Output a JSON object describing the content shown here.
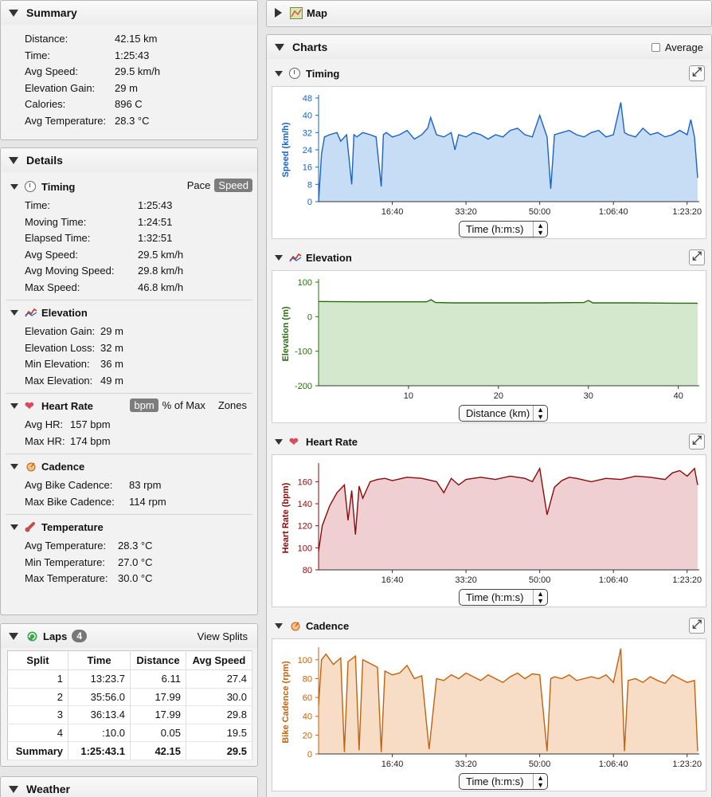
{
  "summary": {
    "title": "Summary",
    "rows": [
      {
        "label": "Distance:",
        "value": "42.15 km"
      },
      {
        "label": "Time:",
        "value": "1:25:43"
      },
      {
        "label": "Avg Speed:",
        "value": "29.5 km/h"
      },
      {
        "label": "Elevation Gain:",
        "value": "29 m"
      },
      {
        "label": "Calories:",
        "value": "896 C"
      },
      {
        "label": "Avg Temperature:",
        "value": "28.3 °C"
      }
    ]
  },
  "details": {
    "title": "Details",
    "timing": {
      "title": "Timing",
      "toggle": {
        "pace": "Pace",
        "speed": "Speed"
      },
      "rows": [
        {
          "label": "Time:",
          "value": "1:25:43"
        },
        {
          "label": "Moving Time:",
          "value": "1:24:51"
        },
        {
          "label": "Elapsed Time:",
          "value": "1:32:51"
        },
        {
          "label": "Avg Speed:",
          "value": "29.5 km/h"
        },
        {
          "label": "Avg Moving Speed:",
          "value": "29.8 km/h"
        },
        {
          "label": "Max Speed:",
          "value": "46.8 km/h"
        }
      ]
    },
    "elevation": {
      "title": "Elevation",
      "rows": [
        {
          "label": "Elevation Gain:",
          "value": "29 m"
        },
        {
          "label": "Elevation Loss:",
          "value": "32 m"
        },
        {
          "label": "Min Elevation:",
          "value": "36 m"
        },
        {
          "label": "Max Elevation:",
          "value": "49 m"
        }
      ]
    },
    "heart_rate": {
      "title": "Heart Rate",
      "toggle": {
        "bpm": "bpm",
        "pct": "% of Max",
        "zones": "Zones"
      },
      "rows": [
        {
          "label": "Avg HR:",
          "value": "157 bpm"
        },
        {
          "label": "Max HR:",
          "value": "174 bpm"
        }
      ]
    },
    "cadence": {
      "title": "Cadence",
      "rows": [
        {
          "label": "Avg Bike Cadence:",
          "value": "83 rpm"
        },
        {
          "label": "Max Bike Cadence:",
          "value": "114 rpm"
        }
      ]
    },
    "temperature": {
      "title": "Temperature",
      "rows": [
        {
          "label": "Avg Temperature:",
          "value": "28.3 °C"
        },
        {
          "label": "Min Temperature:",
          "value": "27.0 °C"
        },
        {
          "label": "Max Temperature:",
          "value": "30.0 °C"
        }
      ]
    }
  },
  "laps": {
    "title": "Laps",
    "count": "4",
    "view_splits": "View Splits",
    "columns": [
      "Split",
      "Time",
      "Distance",
      "Avg Speed"
    ],
    "rows": [
      [
        "1",
        "13:23.7",
        "6.11",
        "27.4"
      ],
      [
        "2",
        "35:56.0",
        "17.99",
        "30.0"
      ],
      [
        "3",
        "36:13.4",
        "17.99",
        "29.8"
      ],
      [
        "4",
        ":10.0",
        "0.05",
        "19.5"
      ]
    ],
    "summary_row": [
      "Summary",
      "1:25:43.1",
      "42.15",
      "29.5"
    ]
  },
  "weather": {
    "title": "Weather"
  },
  "map": {
    "title": "Map"
  },
  "charts": {
    "title": "Charts",
    "average_label": "Average",
    "colors": {
      "speed": "#1a63c6",
      "elevation": "#2a6b12",
      "hr": "#8b0a0a",
      "cadence": "#c4620e"
    }
  },
  "chart_data": [
    {
      "type": "area",
      "title": "Timing",
      "ylabel": "Speed (km/h)",
      "xlabel": "Time (h:m:s)",
      "xlim": [
        0,
        5143
      ],
      "ylim": [
        0,
        48
      ],
      "yticks": [
        0,
        8,
        16,
        24,
        32,
        40,
        48
      ],
      "xticks": [
        1000,
        2000,
        3000,
        4000,
        5000
      ],
      "xticklabels": [
        "16:40",
        "33:20",
        "50:00",
        "1:06:40",
        "1:23:20"
      ],
      "x": [
        0,
        40,
        80,
        150,
        250,
        300,
        380,
        450,
        480,
        520,
        600,
        700,
        780,
        850,
        880,
        920,
        1000,
        1100,
        1200,
        1300,
        1400,
        1480,
        1520,
        1600,
        1700,
        1800,
        1850,
        1900,
        2000,
        2100,
        2200,
        2300,
        2400,
        2500,
        2600,
        2700,
        2800,
        2900,
        3000,
        3100,
        3150,
        3200,
        3300,
        3400,
        3500,
        3600,
        3700,
        3800,
        3900,
        4000,
        4100,
        4150,
        4200,
        4300,
        4400,
        4500,
        4600,
        4700,
        4800,
        4900,
        5000,
        5050,
        5100,
        5143
      ],
      "series": [
        {
          "values": [
            0,
            22,
            30,
            31,
            32,
            28,
            31,
            8,
            31,
            30,
            32,
            31,
            30,
            7,
            31,
            32,
            30,
            31,
            33,
            29,
            31,
            34,
            39,
            31,
            30,
            32,
            24,
            31,
            30,
            32,
            31,
            29,
            31,
            30,
            33,
            34,
            31,
            30,
            40,
            30,
            6,
            31,
            32,
            33,
            31,
            30,
            32,
            33,
            30,
            31,
            46,
            32,
            31,
            30,
            34,
            31,
            32,
            30,
            31,
            33,
            31,
            38,
            30,
            11
          ]
        }
      ]
    },
    {
      "type": "area",
      "title": "Elevation",
      "ylabel": "Elevation (m)",
      "xlabel": "Distance (km)",
      "xlim": [
        0,
        42.15
      ],
      "ylim": [
        -200,
        100
      ],
      "yticks": [
        -200,
        -100,
        0,
        100
      ],
      "xticks": [
        10,
        20,
        30,
        40
      ],
      "x": [
        0,
        5,
        10,
        12,
        12.5,
        13,
        15,
        20,
        25,
        29.5,
        30,
        30.5,
        35,
        40,
        42.15
      ],
      "series": [
        {
          "values": [
            44,
            43,
            43,
            43,
            49,
            41,
            40,
            40,
            40,
            41,
            47,
            40,
            40,
            39,
            39
          ]
        }
      ]
    },
    {
      "type": "area",
      "title": "Heart Rate",
      "ylabel": "Heart Rate (bpm)",
      "xlabel": "Time (h:m:s)",
      "xlim": [
        0,
        5143
      ],
      "ylim": [
        80,
        174
      ],
      "yticks": [
        80,
        100,
        120,
        140,
        160
      ],
      "xticks": [
        1000,
        2000,
        3000,
        4000,
        5000
      ],
      "xticklabels": [
        "16:40",
        "33:20",
        "50:00",
        "1:06:40",
        "1:23:20"
      ],
      "x": [
        0,
        50,
        150,
        250,
        350,
        400,
        450,
        500,
        550,
        600,
        700,
        800,
        900,
        1000,
        1200,
        1400,
        1600,
        1700,
        1800,
        1900,
        2000,
        2200,
        2400,
        2600,
        2800,
        2900,
        3000,
        3100,
        3200,
        3300,
        3400,
        3500,
        3700,
        3900,
        4100,
        4300,
        4500,
        4700,
        4800,
        4900,
        5000,
        5100,
        5143
      ],
      "series": [
        {
          "values": [
            97,
            120,
            138,
            150,
            157,
            125,
            152,
            112,
            156,
            145,
            160,
            162,
            163,
            161,
            164,
            163,
            160,
            150,
            163,
            157,
            162,
            164,
            162,
            165,
            163,
            160,
            172,
            130,
            155,
            161,
            164,
            163,
            160,
            163,
            162,
            165,
            164,
            162,
            168,
            170,
            165,
            172,
            157
          ]
        }
      ]
    },
    {
      "type": "area",
      "title": "Cadence",
      "ylabel": "Bike Cadence (rpm)",
      "xlabel": "Time (h:m:s)",
      "xlim": [
        0,
        5143
      ],
      "ylim": [
        0,
        110
      ],
      "yticks": [
        0,
        20,
        40,
        60,
        80,
        100
      ],
      "xticks": [
        1000,
        2000,
        3000,
        4000,
        5000
      ],
      "xticklabels": [
        "16:40",
        "33:20",
        "50:00",
        "1:06:40",
        "1:23:20"
      ],
      "x": [
        0,
        40,
        100,
        200,
        300,
        350,
        400,
        500,
        550,
        600,
        700,
        800,
        850,
        900,
        1000,
        1100,
        1200,
        1300,
        1400,
        1500,
        1600,
        1700,
        1800,
        1900,
        2000,
        2100,
        2200,
        2300,
        2400,
        2500,
        2600,
        2700,
        2800,
        2900,
        3000,
        3100,
        3150,
        3200,
        3300,
        3400,
        3500,
        3600,
        3700,
        3800,
        3900,
        4000,
        4100,
        4150,
        4200,
        4300,
        4400,
        4500,
        4600,
        4700,
        4800,
        4900,
        5000,
        5100,
        5143
      ],
      "series": [
        {
          "values": [
            52,
            100,
            106,
            95,
            102,
            2,
            98,
            104,
            4,
            100,
            96,
            92,
            2,
            88,
            84,
            86,
            94,
            80,
            83,
            5,
            80,
            78,
            84,
            80,
            86,
            82,
            78,
            84,
            80,
            76,
            82,
            86,
            80,
            85,
            84,
            3,
            80,
            82,
            80,
            84,
            78,
            80,
            82,
            80,
            84,
            76,
            112,
            3,
            78,
            80,
            76,
            82,
            78,
            75,
            84,
            80,
            76,
            78,
            3
          ]
        }
      ]
    }
  ]
}
